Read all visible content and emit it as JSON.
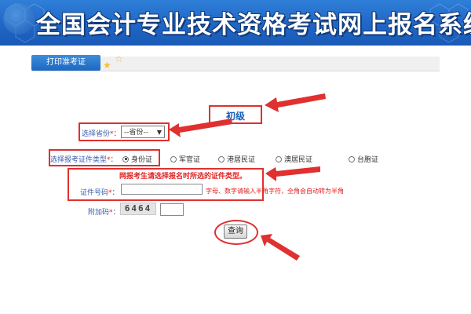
{
  "banner": {
    "title": "全国会计专业技术资格考试网上报名系统"
  },
  "tabs": {
    "print_admission": "打印准考证",
    "star_icon": "star-icon"
  },
  "level": {
    "label": "初级"
  },
  "form": {
    "province_label": "选择省份",
    "province_value": "--省份--",
    "id_type_label": "选择报考证件类型",
    "id_types": [
      {
        "label": "身份证",
        "selected": true
      },
      {
        "label": "军官证",
        "selected": false
      },
      {
        "label": "港居民证",
        "selected": false
      },
      {
        "label": "澳居民证",
        "selected": false
      },
      {
        "label": "台胞证",
        "selected": false
      }
    ],
    "warning": "网报考生请选择报名时所选的证件类型。",
    "id_number_label": "证件号码",
    "id_number_value": "",
    "id_number_hint": "字母、数字请输入半角字符，全角会自动转为半角",
    "captcha_label": "附加码",
    "captcha_value": "6464",
    "captcha_input": "",
    "required_mark": "*",
    "colon": "："
  },
  "actions": {
    "query_label": "查询"
  },
  "colors": {
    "accent_blue": "#1f66c6",
    "highlight_red": "#e03030",
    "label_blue": "#3b5eae"
  }
}
